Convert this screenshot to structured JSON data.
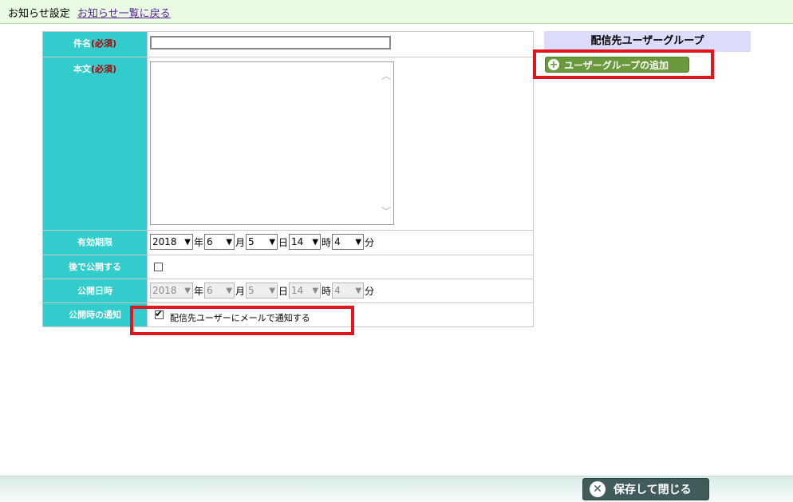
{
  "header": {
    "title": "お知らせ設定",
    "back_link": "お知らせ一覧に戻る"
  },
  "form": {
    "subject_label": "件名",
    "subject_required": "(必須)",
    "subject_value": "",
    "body_label": "本文",
    "body_required": "(必須)",
    "body_value": "",
    "valid_until_label": "有効期限",
    "valid_until": {
      "year": "2018",
      "month": "6",
      "day": "5",
      "hour": "14",
      "minute": "4"
    },
    "publish_later_label": "後で公開する",
    "publish_later_checked": false,
    "publish_at_label": "公開日時",
    "publish_at": {
      "year": "2018",
      "month": "6",
      "day": "5",
      "hour": "14",
      "minute": "4"
    },
    "notify_label": "公開時の通知",
    "notify_checked": true,
    "notify_text": "配信先ユーザーにメールで通知する"
  },
  "units": {
    "year": "年",
    "month": "月",
    "day": "日",
    "hour": "時",
    "minute": "分"
  },
  "groups": {
    "header": "配信先ユーザーグループ",
    "add_button": "ユーザーグループの追加"
  },
  "footer": {
    "save_close": "保存して閉じる"
  },
  "colors": {
    "label_bg": "#33cccc",
    "highlight": "#e0161e",
    "add_button": "#6a9a3c",
    "save_button": "#3f5b5a"
  }
}
